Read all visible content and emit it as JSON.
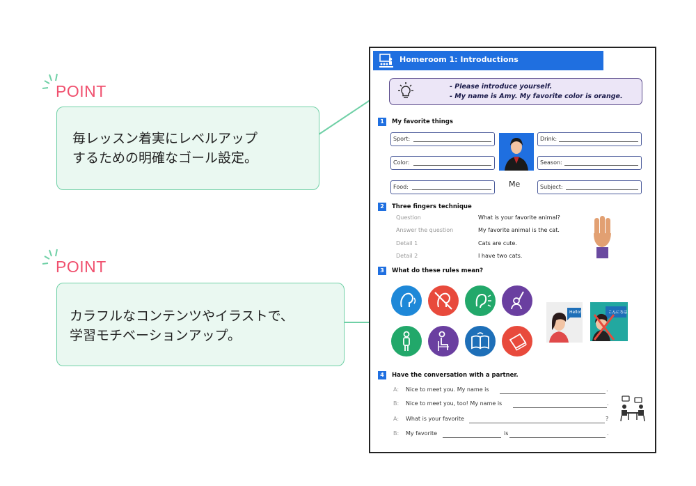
{
  "points": [
    {
      "label": "POINT",
      "text_line1": "毎レッスン着実にレベルアップ",
      "text_line2": "するための明確なゴール設定。"
    },
    {
      "label": "POINT",
      "text_line1": "カラフルなコンテンツやイラストで、",
      "text_line2": "学習モチベーションアップ。"
    }
  ],
  "worksheet": {
    "title": "Homeroom 1: Introductions",
    "goal_line1": "- Please introduce yourself.",
    "goal_line2": "- My name is Amy. My favorite color is orange.",
    "sections": [
      {
        "num": "1",
        "title": "My favorite things"
      },
      {
        "num": "2",
        "title": "Three fingers technique"
      },
      {
        "num": "3",
        "title": "What do these rules mean?"
      },
      {
        "num": "4",
        "title": "Have the conversation with a partner."
      }
    ],
    "favorites": {
      "sport": "Sport:",
      "color": "Color:",
      "food": "Food:",
      "drink": "Drink:",
      "season": "Season:",
      "subject": "Subject:",
      "me_label": "Me"
    },
    "three_fingers": [
      {
        "left": "Question",
        "right": "What is your favorite animal?"
      },
      {
        "left": "Answer the question",
        "right": "My favorite animal is the cat."
      },
      {
        "left": "Detail 1",
        "right": "Cats are cute."
      },
      {
        "left": "Detail 2",
        "right": "I have two cats."
      }
    ],
    "rule_icons": [
      {
        "icon": "speak-icon",
        "color": "#1e88d8"
      },
      {
        "icon": "no-talking-icon",
        "color": "#e84a3c"
      },
      {
        "icon": "listen-icon",
        "color": "#22a86a"
      },
      {
        "icon": "raise-hand-icon",
        "color": "#6a3fa0"
      },
      {
        "icon": "stand-up-icon",
        "color": "#22a86a"
      },
      {
        "icon": "sit-down-icon",
        "color": "#6a3fa0"
      },
      {
        "icon": "open-book-icon",
        "color": "#1e6fb8"
      },
      {
        "icon": "close-book-icon",
        "color": "#e84a3c"
      }
    ],
    "hello_bubble": "Hello!",
    "konnichiwa_bubble": "こんにちは",
    "conversation": [
      {
        "speaker": "A:",
        "text": "Nice to meet you. My name is",
        "end": "."
      },
      {
        "speaker": "B:",
        "text": "Nice to meet you, too! My name is",
        "end": "."
      },
      {
        "speaker": "A:",
        "text": "What is your favorite",
        "end": "?"
      },
      {
        "speaker": "B:",
        "text": "My favorite",
        "mid": "is",
        "end": "."
      }
    ]
  },
  "colors": {
    "accent_pink": "#f0506e",
    "callout_bg": "#eaf8f1",
    "callout_border": "#6fd0a6",
    "header_blue": "#1f6fe0",
    "goal_bg": "#ece6f7"
  }
}
